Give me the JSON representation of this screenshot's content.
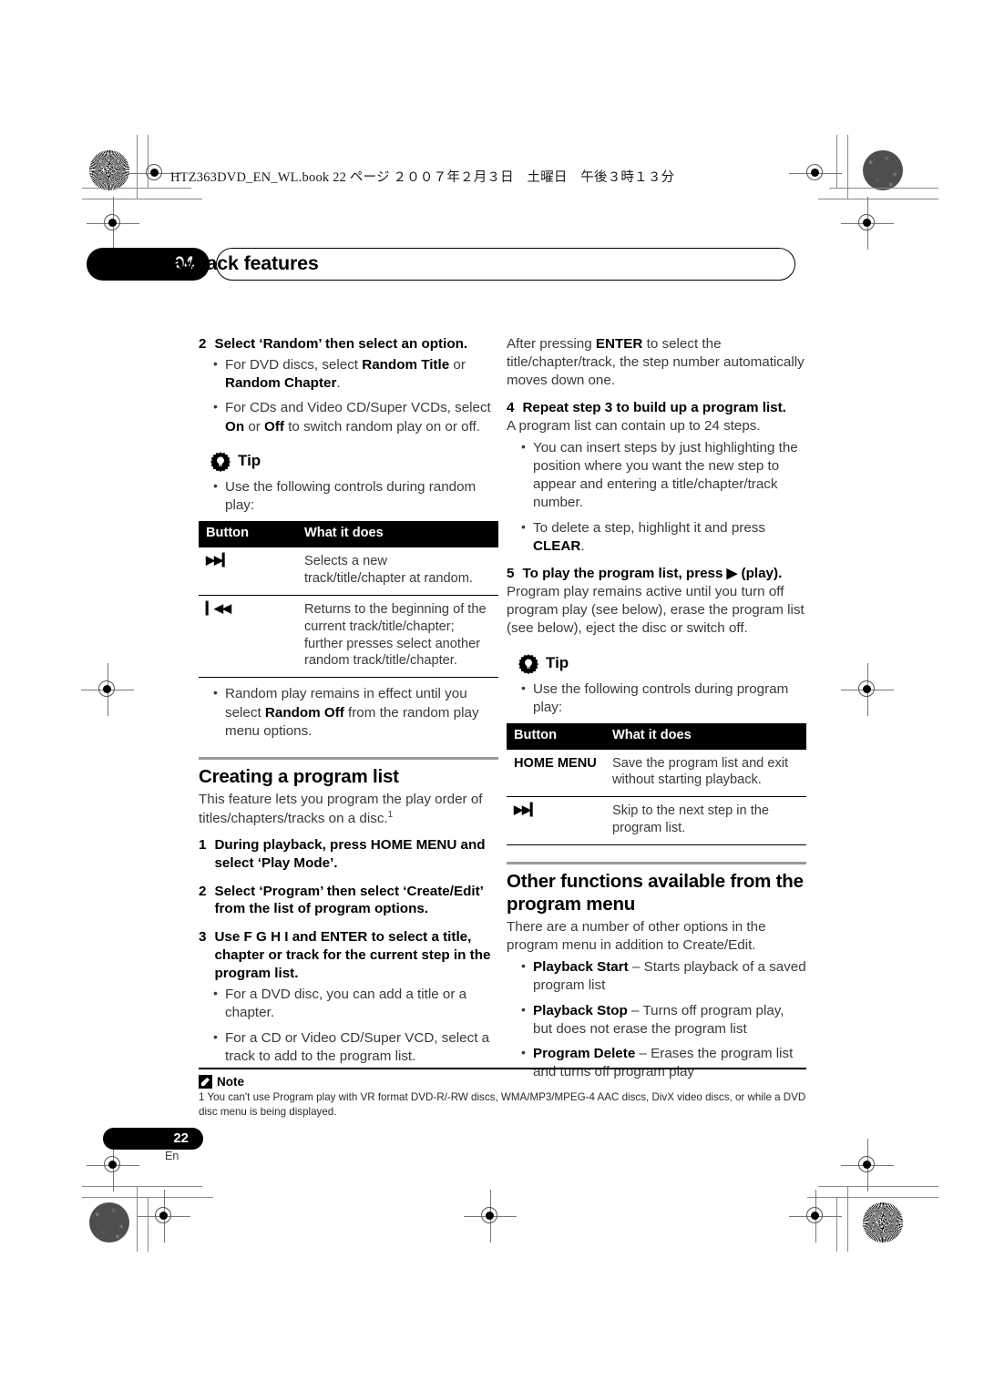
{
  "print_marks": {
    "slug_line": "HTZ363DVD_EN_WL.book  22 ページ  ２００７年２月３日　土曜日　午後３時１３分"
  },
  "header": {
    "chapter_number": "04",
    "chapter_title": "Disc playback features"
  },
  "left_column": {
    "step2": {
      "num": "2",
      "text": "Select ‘Random’ then select an option.",
      "bullets": [
        "For DVD discs, select <b>Random Title</b> or <b>Random Chapter</b>.",
        "For CDs and Video CD/Super VCDs, select <b>On</b> or <b>Off</b> to switch random play on or off."
      ]
    },
    "tip": {
      "label": "Tip",
      "icon": "tip-gear-icon",
      "bullets": [
        "Use the following controls during random play:"
      ]
    },
    "random_table": {
      "headers": [
        "Button",
        "What it does"
      ],
      "rows": [
        {
          "button": "▶▶▎",
          "desc": "Selects a new track/title/chapter at random."
        },
        {
          "button": "▎◀◀",
          "desc": "Returns to the beginning of the current track/title/chapter; further presses select another random track/title/chapter."
        }
      ]
    },
    "after_table_bullets": [
      "Random play remains in effect until you select <b>Random Off</b> from the random play menu options."
    ],
    "section": {
      "title": "Creating a program list",
      "intro": "This feature lets you program the play order of titles/chapters/tracks on a disc.",
      "footnote_marker": "1"
    },
    "steps": [
      {
        "num": "1",
        "text": "During playback, press HOME MENU and select ‘Play Mode’.",
        "bullets": []
      },
      {
        "num": "2",
        "text": "Select ‘Program’ then select ‘Create/Edit’ from the list of program options.",
        "bullets": []
      },
      {
        "num": "3",
        "text": "Use  F  G  H  I and ENTER to select a title, chapter or track for the current step in the program list.",
        "bullets": [
          "For a DVD disc, you can add a title or a chapter.",
          "For a CD or Video CD/Super VCD, select a track to add to the program list."
        ]
      }
    ]
  },
  "right_column": {
    "intro_para": "After pressing <b>ENTER</b> to select the title/chapter/track, the step number automatically moves down one.",
    "step4": {
      "num": "4",
      "text": "Repeat step 3 to build up a program list.",
      "sub_para": "A program list can contain up to 24 steps.",
      "bullets": [
        "You can insert steps by just highlighting the position where you want the new step to appear and entering a title/chapter/track number.",
        "To delete a step, highlight it and press <b>CLEAR</b>."
      ]
    },
    "step5": {
      "num": "5",
      "text": "To play the program list, press ▶ (play).",
      "sub_para": "Program play remains active until you turn off program play (see below), erase the program list (see below), eject the disc or switch off."
    },
    "tip": {
      "label": "Tip",
      "icon": "tip-gear-icon",
      "bullets": [
        "Use the following controls during program play:"
      ]
    },
    "program_table": {
      "headers": [
        "Button",
        "What it does"
      ],
      "rows": [
        {
          "button": "HOME MENU",
          "desc": "Save the program list and exit without starting playback."
        },
        {
          "button": "▶▶▎",
          "desc": "Skip to the next step in the program list."
        }
      ]
    },
    "section": {
      "title": "Other functions available from the program menu",
      "intro": "There are a number of other options in the program menu in addition to Create/Edit.",
      "bullets": [
        "<b>Playback Start</b> – Starts playback of a saved program list",
        "<b>Playback Stop</b> – Turns off program play, but does not erase the program list",
        "<b>Program Delete</b> – Erases the program list and turns off program play"
      ]
    }
  },
  "note": {
    "label": "Note",
    "body": "1 You can't use Program play with VR format DVD-R/-RW discs, WMA/MP3/MPEG-4 AAC discs, DivX video discs, or while a DVD disc menu is being displayed."
  },
  "footer": {
    "page_number": "22",
    "language": "En"
  },
  "colors": {
    "ink": "#000000",
    "body_text": "#3a3a3a",
    "rule_gray": "#9a9a9a"
  }
}
